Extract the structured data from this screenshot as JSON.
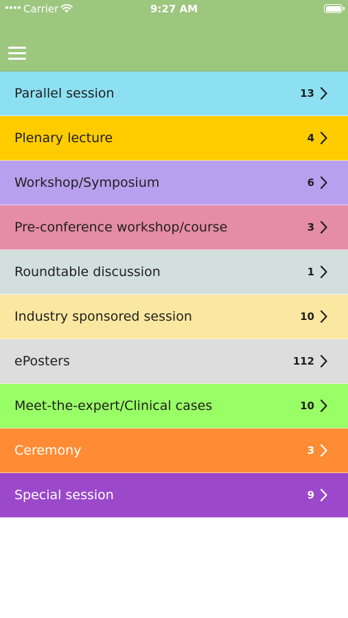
{
  "status_bar": {
    "carrier": "Carrier",
    "time": "9:27 AM"
  },
  "header": {
    "menu_icon": "hamburger-menu-icon",
    "background_color": "#9dc67e"
  },
  "sessions": [
    {
      "label": "Parallel session",
      "count": "13",
      "color": "#8de0f2",
      "text_color": "#1f1f1f"
    },
    {
      "label": "Plenary lecture",
      "count": "4",
      "color": "#ffcc00",
      "text_color": "#1f1f1f"
    },
    {
      "label": "Workshop/Symposium",
      "count": "6",
      "color": "#b9a0ee",
      "text_color": "#1f1f1f"
    },
    {
      "label": "Pre-conference workshop/course",
      "count": "3",
      "color": "#e58ca6",
      "text_color": "#1f1f1f"
    },
    {
      "label": "Roundtable discussion",
      "count": "1",
      "color": "#d3dfdd",
      "text_color": "#1f1f1f"
    },
    {
      "label": "Industry sponsored session",
      "count": "10",
      "color": "#fbe8a0",
      "text_color": "#1f1f1f"
    },
    {
      "label": "ePosters",
      "count": "112",
      "color": "#dddddd",
      "text_color": "#1f1f1f"
    },
    {
      "label": "Meet-the-expert/Clinical cases",
      "count": "10",
      "color": "#99ff66",
      "text_color": "#1f1f1f"
    },
    {
      "label": "Ceremony",
      "count": "3",
      "color": "#ff8c34",
      "text_color": "#ffffff"
    },
    {
      "label": "Special session",
      "count": "9",
      "color": "#9b48cb",
      "text_color": "#ffffff"
    }
  ]
}
